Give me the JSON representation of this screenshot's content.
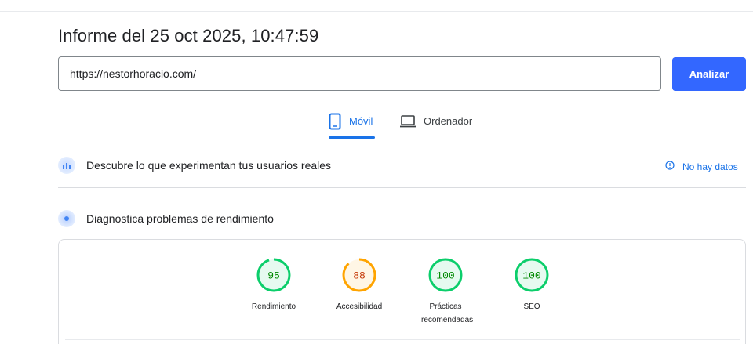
{
  "report": {
    "title": "Informe del 25 oct 2025, 10:47:59"
  },
  "search": {
    "url_value": "https://nestorhoracio.com/",
    "analyze_label": "Analizar"
  },
  "tabs": [
    {
      "label": "Móvil",
      "icon": "smartphone-icon",
      "selected": true
    },
    {
      "label": "Ordenador",
      "icon": "laptop-icon",
      "selected": false
    }
  ],
  "field_data": {
    "title": "Descubre lo que experimentan tus usuarios reales",
    "status": "No hay datos",
    "icon": "users-chart-icon",
    "status_icon": "info-icon"
  },
  "lab_data": {
    "title": "Diagnostica problemas de rendimiento",
    "icon": "gauge-icon"
  },
  "scores": [
    {
      "value": "95",
      "label": "Rendimiento",
      "color": "#0cce6b",
      "text_color": "#008800",
      "fraction": 0.95
    },
    {
      "value": "88",
      "label": "Accesibilidad",
      "color": "#ffa400",
      "text_color": "#c33300",
      "fraction": 0.88
    },
    {
      "value": "100",
      "label": "Prácticas recomendadas",
      "color": "#0cce6b",
      "text_color": "#008800",
      "fraction": 1.0
    },
    {
      "value": "100",
      "label": "SEO",
      "color": "#0cce6b",
      "text_color": "#008800",
      "fraction": 1.0
    }
  ],
  "colors": {
    "accent": "#1a73e8",
    "button": "#3367ff"
  }
}
